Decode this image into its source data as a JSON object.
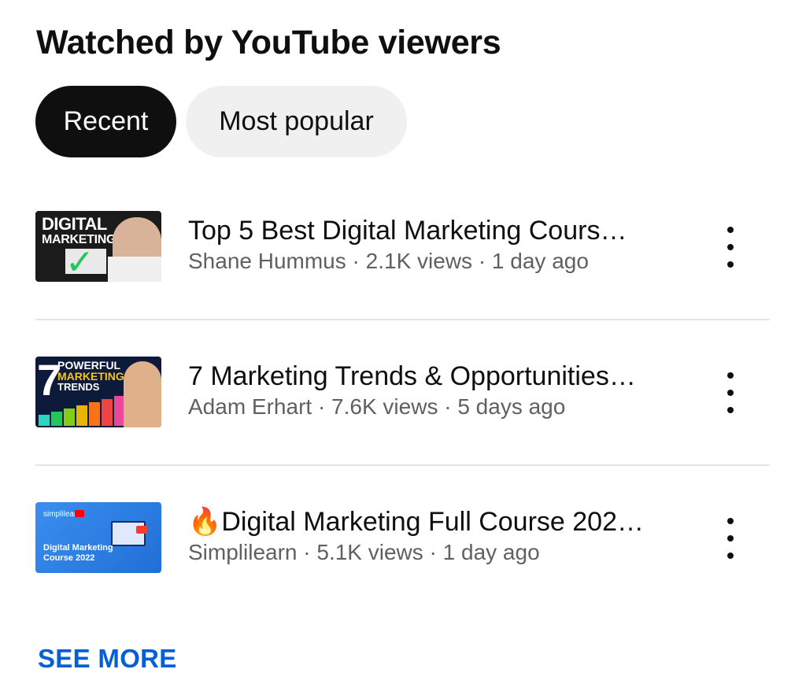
{
  "section": {
    "title": "Watched by YouTube viewers"
  },
  "chips": [
    {
      "label": "Recent",
      "active": true
    },
    {
      "label": "Most popular",
      "active": false
    }
  ],
  "videos": [
    {
      "title": "Top 5 Best Digital Marketing Cours…",
      "channel": "Shane Hummus",
      "views": "2.1K views",
      "age": "1 day ago",
      "subtitle": "Shane Hummus · 2.1K views · 1 day ago",
      "thumb": {
        "line1": "DIGITAL",
        "line2": "MARKETING"
      }
    },
    {
      "title": "7 Marketing Trends & Opportunities…",
      "channel": "Adam Erhart",
      "views": "7.6K views",
      "age": "5 days ago",
      "subtitle": "Adam Erhart · 7.6K views · 5 days ago",
      "thumb": {
        "big": "7",
        "line1": "POWERFUL",
        "line2": "MARKETING",
        "line3": "TRENDS"
      }
    },
    {
      "title": "🔥Digital Marketing Full Course 202…",
      "channel": "Simplilearn",
      "views": "5.1K views",
      "age": "1 day ago",
      "subtitle": "Simplilearn · 5.1K views · 1 day ago",
      "thumb": {
        "brand": "simplilearn",
        "line1": "Digital Marketing",
        "line2": "Course 2022"
      }
    }
  ],
  "see_more": "SEE MORE",
  "colors": {
    "accent": "#065fd4",
    "chip_active_bg": "#0f0f0f",
    "chip_inactive_bg": "#f0f0f0",
    "secondary_text": "#606060",
    "divider": "#e5e5e5"
  },
  "icons": {
    "more": "more-vert-icon"
  }
}
